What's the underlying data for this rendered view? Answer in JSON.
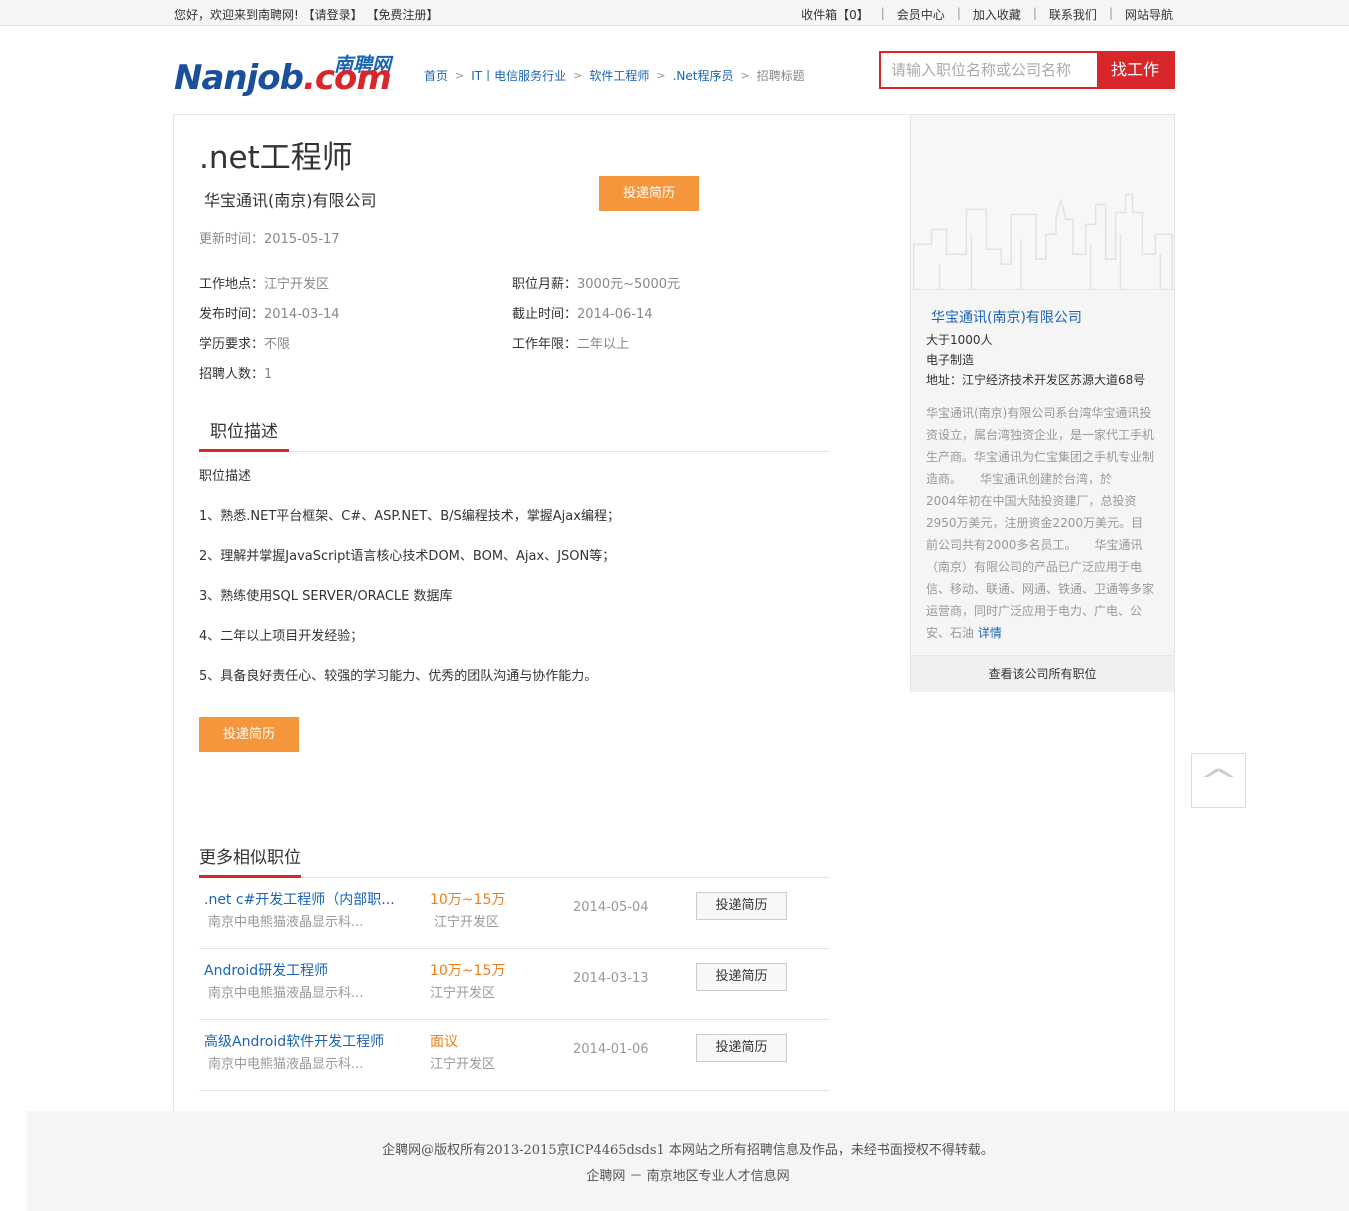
{
  "topbar": {
    "welcome": "您好，欢迎来到南聘网!",
    "login": "【请登录】",
    "register": "【免费注册】",
    "links": [
      "收件箱【0】",
      "会员中心",
      "加入收藏",
      "联系我们",
      "网站导航"
    ]
  },
  "logo": {
    "cn": "南聘网",
    "en_main": "Nanjob",
    "en_suffix": ".com"
  },
  "breadcrumb": [
    "首页",
    "IT丨电信服务行业",
    "软件工程师",
    ".Net程序员",
    "招聘标题"
  ],
  "search": {
    "placeholder": "请输入职位名称或公司名称",
    "button": "找工作"
  },
  "job": {
    "title": ".net工程师",
    "company": "华宝通讯(南京)有限公司",
    "apply_label": "投递简历",
    "update_label": "更新时间：",
    "update_value": "2015-05-17",
    "fields": {
      "location_k": "工作地点：",
      "location_v": "江宁开发区",
      "salary_k": "职位月薪：",
      "salary_v": "3000元~5000元",
      "publish_k": "发布时间：",
      "publish_v": "2014-03-14",
      "deadline_k": "截止时间：",
      "deadline_v": "2014-06-14",
      "edu_k": "学历要求：",
      "edu_v": "不限",
      "exp_k": "工作年限：",
      "exp_v": "二年以上",
      "count_k": "招聘人数：",
      "count_v": "1"
    },
    "desc_title": "职位描述",
    "desc_subtitle": "职位描述",
    "desc_items": [
      "1、熟悉.NET平台框架、C#、ASP.NET、B/S编程技术，掌握Ajax编程；",
      "2、理解并掌握JavaScript语言核心技术DOM、BOM、Ajax、JSON等；",
      "3、熟练使用SQL SERVER/ORACLE 数据库",
      "4、二年以上项目开发经验；",
      "5、具备良好责任心、较强的学习能力、优秀的团队沟通与协作能力。"
    ]
  },
  "sidebar": {
    "company": "华宝通讯(南京)有限公司",
    "size": "大于1000人",
    "industry": "电子制造",
    "address": "地址：江宁经济技术开发区苏源大道68号",
    "intro_lines": [
      "华宝通讯(南京)有限公司系台湾华宝通讯投",
      "资设立，属台湾独资企业，是一家代工手机",
      "生产商。华宝通讯为仁宝集团之手机专业制",
      "造商。　　华宝通讯创建於台湾，於",
      "2004年初在中国大陆投资建厂，总投资",
      "2950万美元，注册资金2200万美元。目",
      "前公司共有2000多名员工。　　华宝通讯",
      "（南京）有限公司的产品已广泛应用于电",
      "信、移动、联通、网通、铁通、卫通等多家",
      "运营商，同时广泛应用于电力、广电、公",
      "安、石油"
    ],
    "more": "详情",
    "all_jobs": "查看该公司所有职位"
  },
  "backtop": "^",
  "similar": {
    "title": "更多相似职位",
    "apply_label": "投递简历",
    "rows": [
      {
        "title": ".net c#开发工程师（内部职...",
        "company": "南京中电熊猫液晶显示科...",
        "salary": "10万~15万",
        "location": "江宁开发区",
        "date": "2014-05-04"
      },
      {
        "title": "Android研发工程师",
        "company": "南京中电熊猫液晶显示科...",
        "salary": "10万~15万",
        "location": "江宁开发区",
        "date": "2014-03-13"
      },
      {
        "title": "高级Android软件开发工程师",
        "company": "南京中电熊猫液晶显示科...",
        "salary": "面议",
        "location": "江宁开发区",
        "date": "2014-01-06"
      }
    ]
  },
  "footer": {
    "line1": "企聘网@版权所有2013-2015京ICP4465dsds1 本网站之所有招聘信息及作品，未经书面授权不得转载。",
    "line2": "企聘网 － 南京地区专业人才信息网"
  }
}
